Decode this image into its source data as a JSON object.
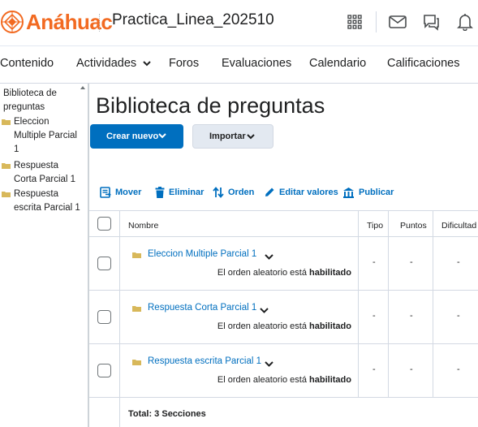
{
  "header": {
    "logo_text": "Anáhuac",
    "course_title": "Practica_Linea_202510",
    "icons": [
      "app-grid-icon",
      "mail-icon",
      "chat-icon",
      "bell-icon"
    ]
  },
  "nav": {
    "items": [
      {
        "label": "Contenido"
      },
      {
        "label": "Actividades"
      },
      {
        "label": "Foros"
      },
      {
        "label": "Evaluaciones"
      },
      {
        "label": "Calendario"
      },
      {
        "label": "Calificaciones"
      }
    ]
  },
  "sidebar": {
    "root": {
      "line1": "Biblioteca de",
      "line2": "preguntas"
    },
    "items": [
      {
        "lines": [
          "Eleccion",
          "Multiple Parcial",
          "1"
        ]
      },
      {
        "lines": [
          "Respuesta",
          "Corta Parcial 1"
        ]
      },
      {
        "lines": [
          "Respuesta",
          "escrita Parcial 1"
        ]
      }
    ]
  },
  "main": {
    "title": "Biblioteca de preguntas",
    "create_label": "Crear nuevo",
    "import_label": "Importar",
    "actions": [
      {
        "label": "Mover",
        "icon": "move-icon"
      },
      {
        "label": "Eliminar",
        "icon": "trash-icon"
      },
      {
        "label": "Orden",
        "icon": "sort-icon"
      },
      {
        "label": "Editar valores",
        "icon": "pencil-icon"
      },
      {
        "label": "Publicar",
        "icon": "publish-icon"
      }
    ],
    "table": {
      "headers": {
        "name": "Nombre",
        "type": "Tipo",
        "points": "Puntos",
        "difficulty": "Dificultad"
      },
      "rows": [
        {
          "name": "Eleccion Multiple Parcial 1",
          "desc_prefix": "El orden aleatorio está",
          "desc_status": "habilitado",
          "type": "-",
          "points": "-",
          "difficulty": "-"
        },
        {
          "name": "Respuesta Corta Parcial 1",
          "desc_prefix": "El orden aleatorio está",
          "desc_status": "habilitado",
          "type": "-",
          "points": "-",
          "difficulty": "-"
        },
        {
          "name": "Respuesta escrita Parcial 1",
          "desc_prefix": "El orden aleatorio está",
          "desc_status": "habilitado",
          "type": "-",
          "points": "-",
          "difficulty": "-"
        }
      ],
      "total": "Total:  3 Secciones"
    }
  },
  "colors": {
    "brand_orange": "#f26a21",
    "primary_blue": "#006fbf",
    "link_blue": "#006fbf",
    "folder_yellow": "#d8b85a"
  }
}
